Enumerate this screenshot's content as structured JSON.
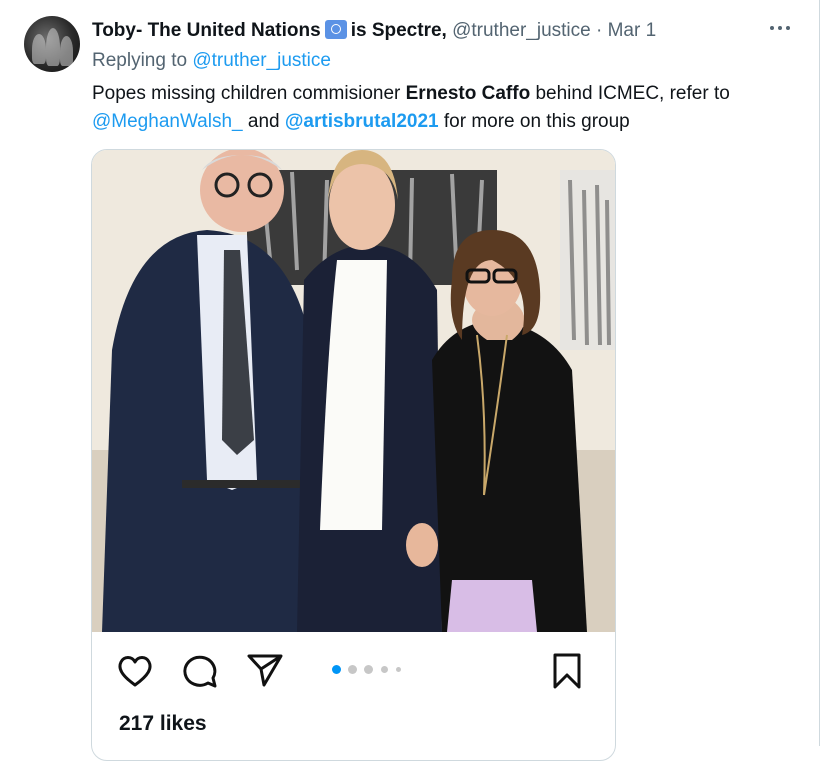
{
  "author": {
    "display_name_part1": "Toby- The United Nations",
    "flag_icon": "un-flag-icon",
    "display_name_part2": "is Spectre,",
    "handle": "@truther_justice",
    "separator": "·",
    "date": "Mar 1"
  },
  "more_label": "···",
  "reply": {
    "prefix": "Replying to",
    "to": "@truther_justice"
  },
  "body": {
    "t1": "Popes missing children commisioner ",
    "bold": "Ernesto Caffo",
    "t2": " behind ICMEC, refer to ",
    "mention1": "@MeghanWalsh_",
    "t3": "  and ",
    "mention2": "@artisbrutal2021",
    "t4": " for more on this group"
  },
  "embedded_post": {
    "photo_description_icon": "photo",
    "likes": "217 likes",
    "carousel_total": 5,
    "carousel_active": 1,
    "colors": {
      "carousel_active": "#0095f6",
      "carousel_inactive": "#c7c7c7"
    }
  },
  "colors": {
    "link": "#1d9bf0",
    "muted": "#536471",
    "text": "#0f1419"
  }
}
